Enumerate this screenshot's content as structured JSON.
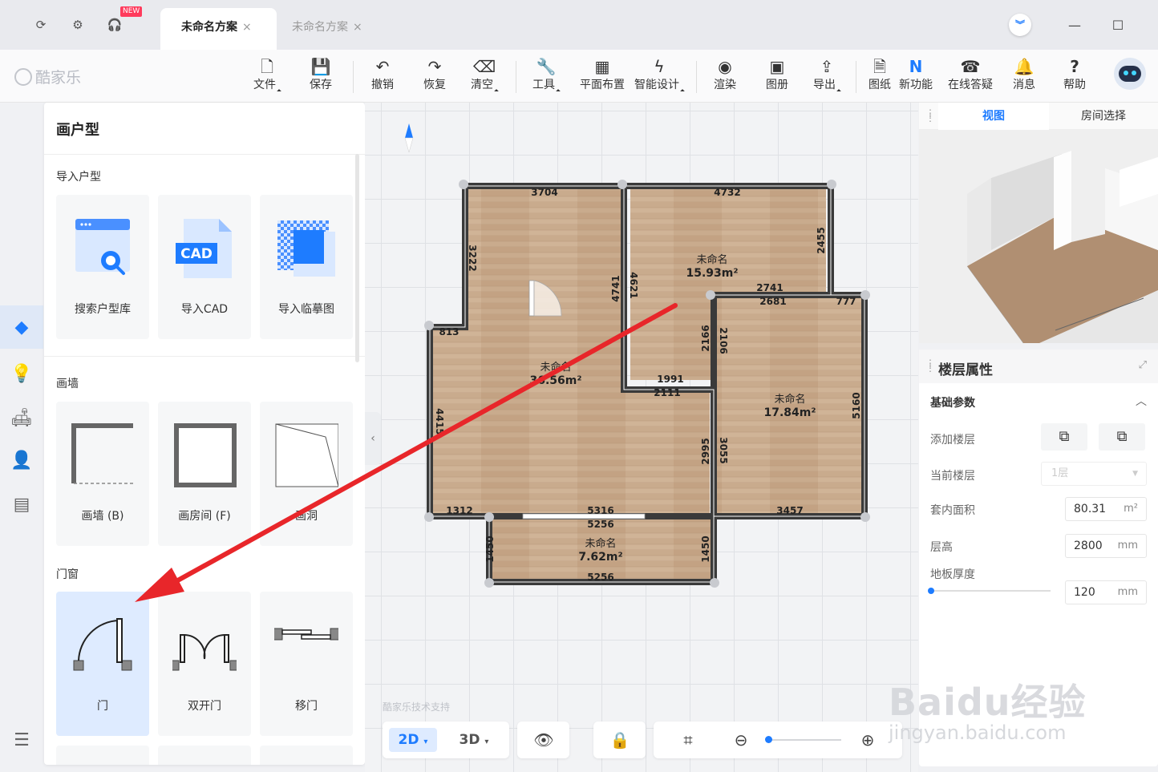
{
  "titlebar": {
    "new_badge": "NEW",
    "tabs": [
      {
        "label": "未命名方案",
        "close": "×",
        "active": true
      },
      {
        "label": "未命名方案",
        "close": "×",
        "active": false
      }
    ],
    "icons": [
      "refresh-icon",
      "plugin-icon",
      "headset-icon"
    ]
  },
  "toolbar": {
    "logo": "酷家乐",
    "items": [
      {
        "label": "文件",
        "icon": "file-icon",
        "glyph": "🗋"
      },
      {
        "label": "保存",
        "icon": "save-icon",
        "glyph": "💾"
      },
      {
        "label": "撤销",
        "icon": "undo-icon",
        "glyph": "↶"
      },
      {
        "label": "恢复",
        "icon": "redo-icon",
        "glyph": "↷"
      },
      {
        "label": "清空",
        "icon": "eraser-icon",
        "glyph": "⌫"
      },
      {
        "label": "工具",
        "icon": "wrench-icon",
        "glyph": "🔧"
      },
      {
        "label": "平面布置",
        "icon": "layout-icon",
        "glyph": "▦"
      },
      {
        "label": "智能设计",
        "icon": "lightning-icon",
        "glyph": "ϟ"
      },
      {
        "label": "渲染",
        "icon": "camera-icon",
        "glyph": "◉"
      },
      {
        "label": "图册",
        "icon": "album-icon",
        "glyph": "▣"
      },
      {
        "label": "导出",
        "icon": "export-icon",
        "glyph": "⇪"
      },
      {
        "label": "图纸",
        "icon": "drawing-icon",
        "glyph": "🗎"
      },
      {
        "label": "新功能",
        "icon": "new-feature-icon",
        "glyph": "N"
      },
      {
        "label": "在线答疑",
        "icon": "support-icon",
        "glyph": "☎"
      },
      {
        "label": "消息",
        "icon": "bell-icon",
        "glyph": "🔔"
      },
      {
        "label": "帮助",
        "icon": "help-icon",
        "glyph": "?"
      }
    ]
  },
  "panel": {
    "title": "画户型",
    "sections": [
      {
        "title": "导入户型",
        "cards": [
          "搜索户型库",
          "导入CAD",
          "导入临摹图"
        ]
      },
      {
        "title": "画墙",
        "cards": [
          "画墙 (B)",
          "画房间 (F)",
          "画洞"
        ]
      },
      {
        "title": "门窗",
        "cards": [
          "门",
          "双开门",
          "移门"
        ]
      }
    ],
    "cad_text": "CAD"
  },
  "floorplan": {
    "rooms": [
      {
        "name": "未命名",
        "area": "36.56m²"
      },
      {
        "name": "未命名",
        "area": "15.93m²"
      },
      {
        "name": "未命名",
        "area": "17.84m²"
      },
      {
        "name": "未命名",
        "area": "7.62m²"
      }
    ],
    "dims": [
      "3704",
      "4732",
      "3222",
      "4741",
      "4621",
      "2455",
      "2741",
      "2681",
      "777",
      "813",
      "2166",
      "2106",
      "1991",
      "2111",
      "4415",
      "5160",
      "2995",
      "3055",
      "1312",
      "5316",
      "5256",
      "3457",
      "1450",
      "1450",
      "5256"
    ],
    "support_text": "酷家乐技术支持"
  },
  "bottom": {
    "mode_2d": "2D",
    "mode_3d": "3D",
    "zoom_level": 0.02
  },
  "preview": {
    "tab_view": "视图",
    "tab_room": "房间选择"
  },
  "props": {
    "title": "楼层属性",
    "section": "基础参数",
    "add_floor": "添加楼层",
    "current_floor": "当前楼层",
    "current_floor_value": "1层",
    "inner_area": "套内面积",
    "inner_area_value": "80.31",
    "inner_area_unit": "m²",
    "height": "层高",
    "height_value": "2800",
    "height_unit": "mm",
    "floor_thickness": "地板厚度",
    "floor_thickness_value": "120",
    "floor_thickness_unit": "mm"
  },
  "watermark": {
    "main": "Baidu经验",
    "url": "jingyan.baidu.com"
  },
  "colors": {
    "accent": "#1e7cff",
    "arrow": "#e8262a",
    "wall": "#3a3a3a",
    "floor": "#c8a98a"
  }
}
